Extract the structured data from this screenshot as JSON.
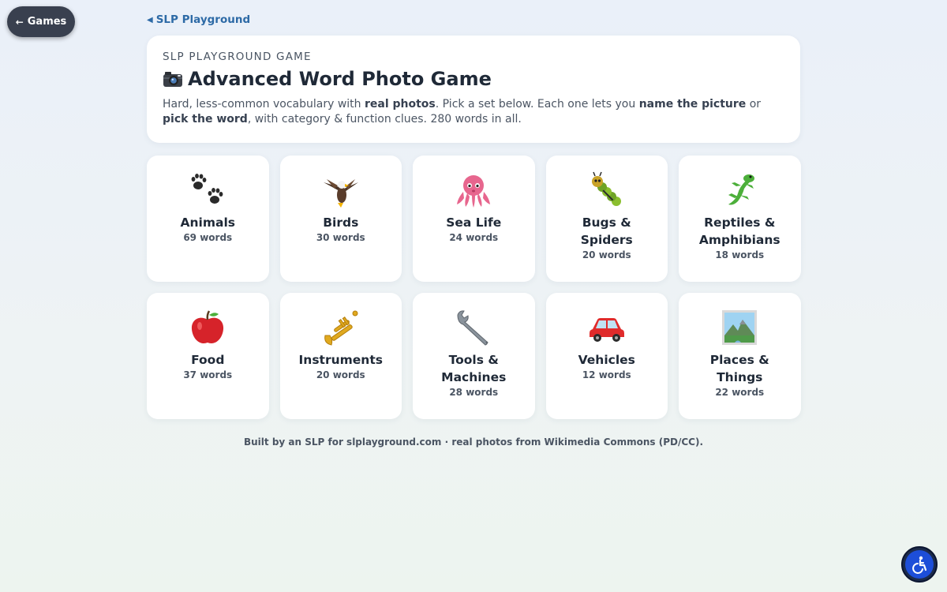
{
  "nav": {
    "games_button": "Games",
    "back_link": "SLP Playground"
  },
  "header": {
    "eyebrow": "SLP PLAYGROUND GAME",
    "title": "Advanced Word Photo Game",
    "title_icon": "camera-icon",
    "desc_1": "Hard, less-common vocabulary with ",
    "desc_b1": "real photos",
    "desc_2": ". Pick a set below. Each one lets you ",
    "desc_b2": "name the picture",
    "desc_3": " or ",
    "desc_b3": "pick the word",
    "desc_4": ", with category & function clues. 280 words in all."
  },
  "categories": [
    {
      "name": "Animals",
      "count": "69 words",
      "icon": "paw-prints-icon"
    },
    {
      "name": "Birds",
      "count": "30 words",
      "icon": "eagle-icon"
    },
    {
      "name": "Sea Life",
      "count": "24 words",
      "icon": "octopus-icon"
    },
    {
      "name": "Bugs & Spiders",
      "count": "20 words",
      "icon": "caterpillar-icon"
    },
    {
      "name": "Reptiles & Amphibians",
      "count": "18 words",
      "icon": "lizard-icon"
    },
    {
      "name": "Food",
      "count": "37 words",
      "icon": "apple-icon"
    },
    {
      "name": "Instruments",
      "count": "20 words",
      "icon": "trumpet-icon"
    },
    {
      "name": "Tools & Machines",
      "count": "28 words",
      "icon": "wrench-icon"
    },
    {
      "name": "Vehicles",
      "count": "12 words",
      "icon": "car-icon"
    },
    {
      "name": "Places & Things",
      "count": "22 words",
      "icon": "landscape-icon"
    }
  ],
  "footer": "Built by an SLP for slplayground.com · real photos from Wikimedia Commons (PD/CC).",
  "colors": {
    "games_button": "#39404f",
    "link": "#2d6aa6",
    "accessibility_button": "#1d4ed8"
  }
}
